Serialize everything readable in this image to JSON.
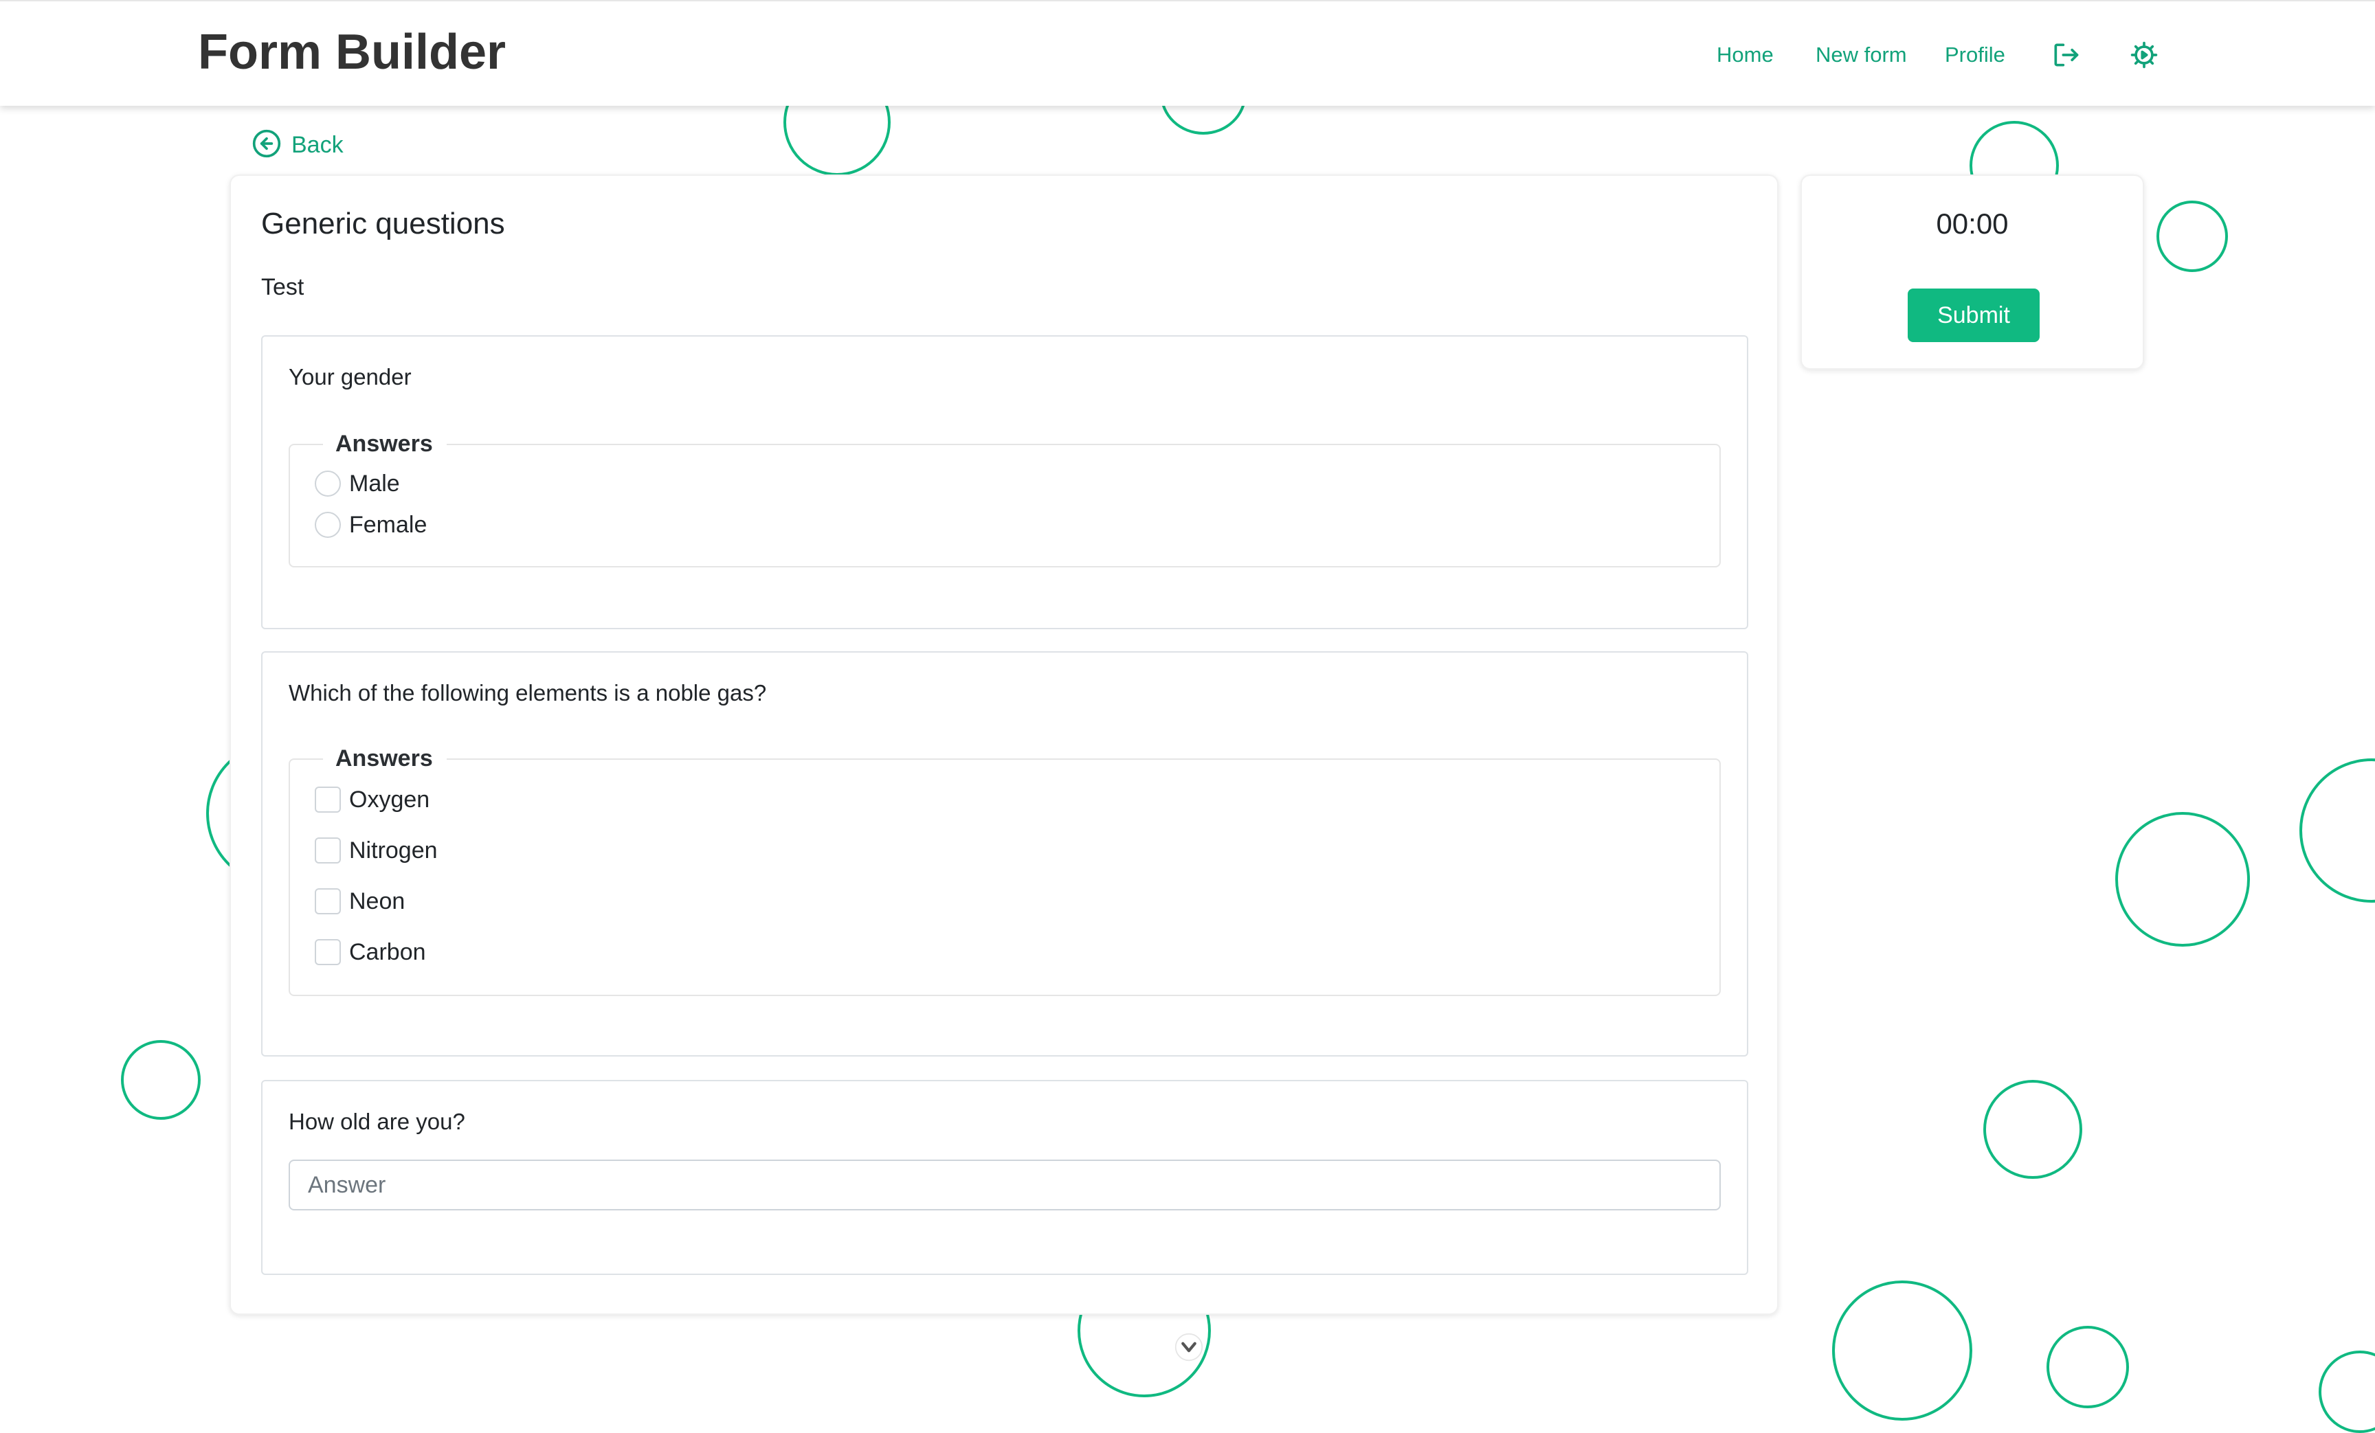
{
  "app": {
    "brand": "Form Builder"
  },
  "nav": {
    "home": "Home",
    "new_form": "New form",
    "profile": "Profile",
    "logout_icon": "logout-icon",
    "settings_icon": "gear-icon"
  },
  "back": {
    "label": "Back",
    "icon": "arrow-left-circle-icon"
  },
  "form": {
    "title": "Generic questions",
    "description": "Test"
  },
  "questions": [
    {
      "text": "Your gender",
      "type": "radio",
      "legend": "Answers",
      "options": [
        "Male",
        "Female"
      ]
    },
    {
      "text": "Which of the following elements is a noble gas?",
      "type": "checkbox",
      "legend": "Answers",
      "options": [
        "Oxygen",
        "Nitrogen",
        "Neon",
        "Carbon"
      ]
    },
    {
      "text": "How old are you?",
      "type": "text",
      "placeholder": "Answer",
      "value": ""
    }
  ],
  "side": {
    "timer": "00:00",
    "submit_label": "Submit"
  },
  "colors": {
    "accent": "#10b981",
    "link": "#12a27a",
    "brand_text": "#333333"
  }
}
